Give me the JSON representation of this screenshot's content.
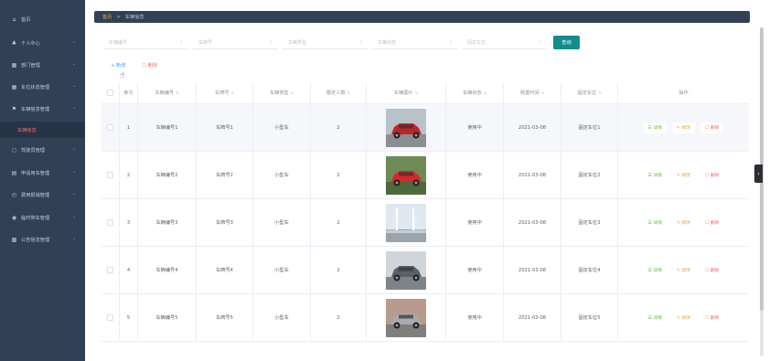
{
  "sidebar": {
    "items": [
      {
        "label": "首页",
        "icon": "home-icon",
        "glyph": "⌂",
        "chevron": false
      },
      {
        "label": "个人中心",
        "icon": "user-icon",
        "glyph": "♣",
        "chevron": true
      },
      {
        "label": "部门管理",
        "icon": "grid-icon",
        "glyph": "▦",
        "chevron": true
      },
      {
        "label": "车位状态管理",
        "icon": "grid-icon",
        "glyph": "▦",
        "chevron": true
      },
      {
        "label": "车辆信息管理",
        "icon": "flag-icon",
        "glyph": "⚑",
        "chevron": true
      },
      {
        "label": "车辆信息",
        "icon": "",
        "glyph": "",
        "chevron": false,
        "sub": true
      },
      {
        "label": "驾驶员管理",
        "icon": "chat-icon",
        "glyph": "○",
        "chevron": true
      },
      {
        "label": "申请用车管理",
        "icon": "list-icon",
        "glyph": "▤",
        "chevron": true
      },
      {
        "label": "费用报销管理",
        "icon": "clock-icon",
        "glyph": "◴",
        "chevron": true
      },
      {
        "label": "临时停车管理",
        "icon": "location-icon",
        "glyph": "◉",
        "chevron": true
      },
      {
        "label": "公告信息管理",
        "icon": "apps-icon",
        "glyph": "▩",
        "chevron": true
      }
    ]
  },
  "breadcrumb": {
    "home": "首页",
    "separator": ">",
    "current": "车辆信息"
  },
  "search": {
    "fields": [
      {
        "placeholder": "车辆编号"
      },
      {
        "placeholder": "车牌号"
      },
      {
        "placeholder": "车辆类型"
      },
      {
        "placeholder": "车辆状态"
      },
      {
        "placeholder": "固定车位"
      }
    ],
    "search_icon": "⌕",
    "query_label": "查询"
  },
  "toolbar": {
    "add_label": "+ 新增",
    "delete_label": "☐ 删除"
  },
  "table": {
    "headers": [
      "索引",
      "车辆编号",
      "车牌号",
      "车辆类型",
      "额定人数",
      "车辆图片",
      "车辆状态",
      "购置时间",
      "固定车位",
      "操作"
    ],
    "sortable": [
      false,
      true,
      true,
      true,
      true,
      true,
      true,
      true,
      true,
      false
    ],
    "rows": [
      {
        "index": "1",
        "code": "车辆编号1",
        "plate": "车牌号1",
        "type": "小型车",
        "seats": "2",
        "status": "使用中",
        "date": "2021-03-08",
        "spot": "固定车位1",
        "image": "red-suv"
      },
      {
        "index": "2",
        "code": "车辆编号2",
        "plate": "车牌号2",
        "type": "小型车",
        "seats": "2",
        "status": "使用中",
        "date": "2021-03-08",
        "spot": "固定车位2",
        "image": "red-coupe"
      },
      {
        "index": "3",
        "code": "车辆编号3",
        "plate": "车牌号3",
        "type": "小型车",
        "seats": "2",
        "status": "使用中",
        "date": "2021-03-08",
        "spot": "固定车位3",
        "image": "bridge"
      },
      {
        "index": "4",
        "code": "车辆编号4",
        "plate": "车牌号4",
        "type": "小型车",
        "seats": "2",
        "status": "使用中",
        "date": "2021-03-08",
        "spot": "固定车位4",
        "image": "grey-suv"
      },
      {
        "index": "5",
        "code": "车辆编号5",
        "plate": "车牌号5",
        "type": "小型车",
        "seats": "2",
        "status": "使用中",
        "date": "2021-03-08",
        "spot": "固定车位5",
        "image": "silver-suv"
      }
    ],
    "ops": {
      "detail": "☰ 详情",
      "edit": "✎ 修改",
      "remove": "☐ 删除"
    }
  },
  "colors": {
    "sidebar_bg": "#304156",
    "accent": "#148c8c",
    "danger": "#f56c6c",
    "success": "#67c23a",
    "warning": "#e6a23c"
  }
}
